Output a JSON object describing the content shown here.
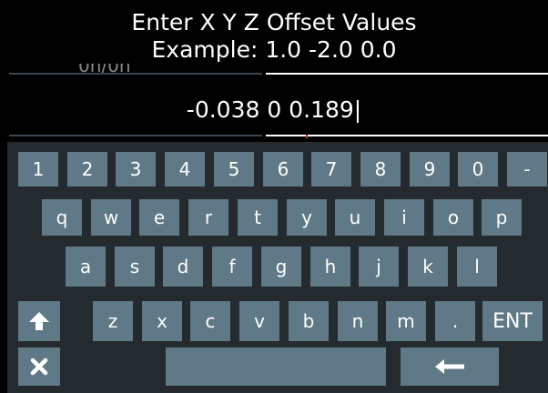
{
  "header": {
    "line1": "Enter X Y Z Offset Values",
    "line2": "Example: 1.0 -2.0 0.0"
  },
  "input": {
    "value": "-0.038 0 0.189|"
  },
  "keyboard": {
    "colors": {
      "panel": "#242a2e",
      "key": "#5f7a86",
      "text": "#ffffff",
      "cursor_tick": "#c23a2a"
    },
    "rows": [
      [
        "1",
        "2",
        "3",
        "4",
        "5",
        "6",
        "7",
        "8",
        "9",
        "0",
        "-"
      ],
      [
        "q",
        "w",
        "e",
        "r",
        "t",
        "y",
        "u",
        "i",
        "o",
        "p"
      ],
      [
        "a",
        "s",
        "d",
        "f",
        "g",
        "h",
        "j",
        "k",
        "l"
      ],
      [
        "z",
        "x",
        "c",
        "v",
        "b",
        "n",
        "m",
        "."
      ]
    ],
    "enter_label": "ENT",
    "special_keys": {
      "shift": "up-arrow-icon",
      "cancel": "close-icon",
      "space": "space",
      "backspace": "left-arrow-icon"
    }
  }
}
